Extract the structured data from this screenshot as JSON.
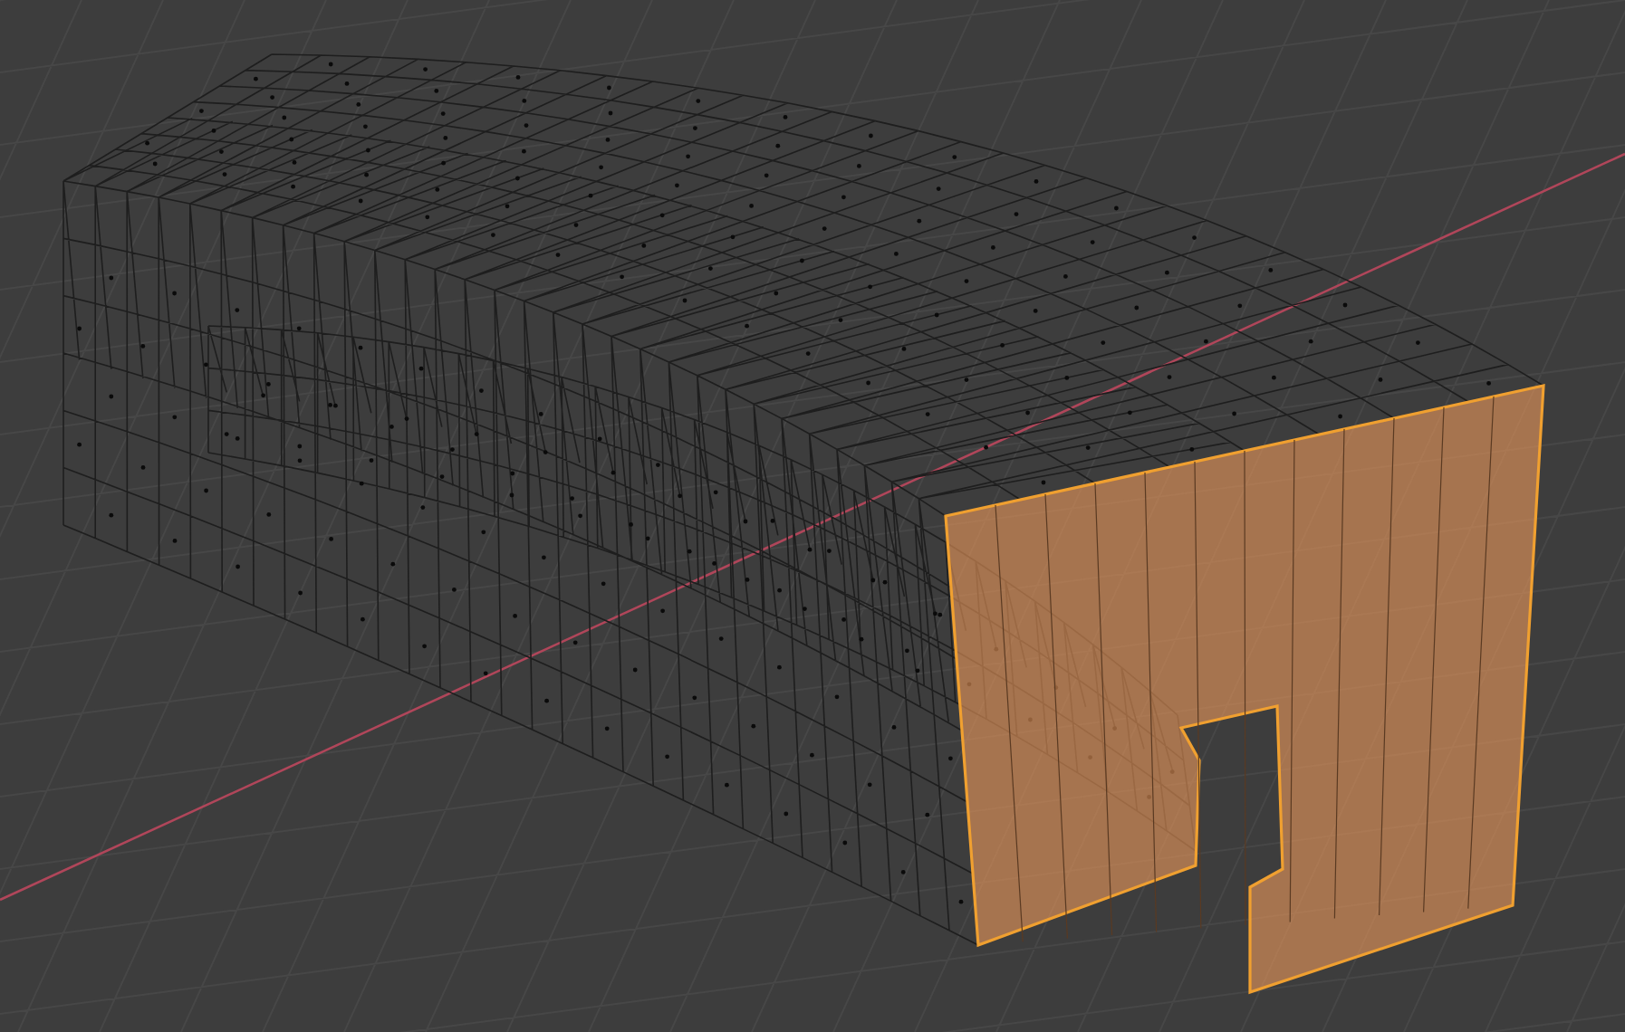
{
  "viewport": {
    "mesh": {
      "end_face": {
        "selected": true
      }
    }
  }
}
